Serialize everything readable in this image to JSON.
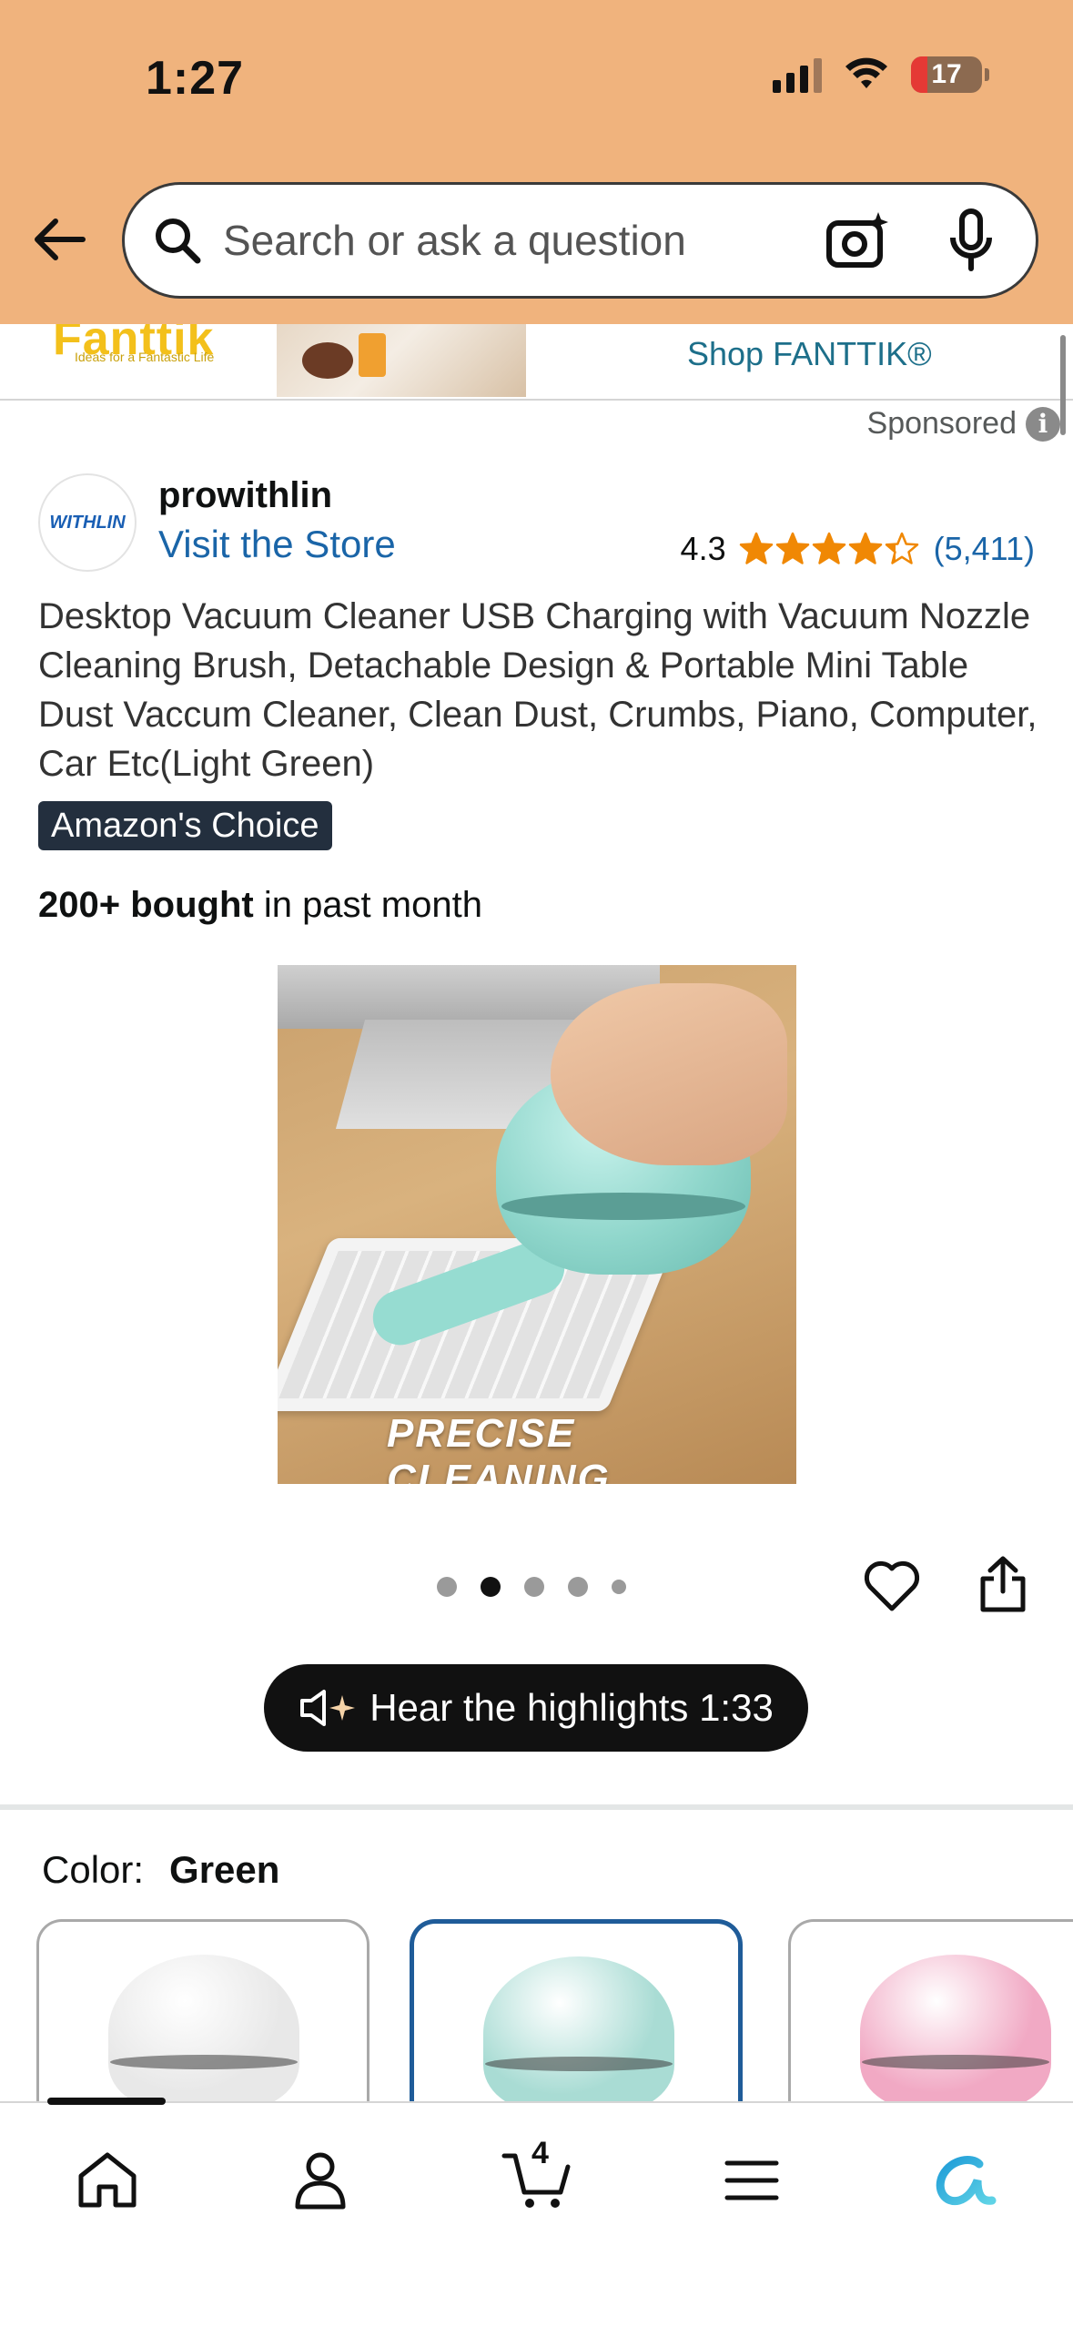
{
  "status_bar": {
    "time": "1:27",
    "battery": "17"
  },
  "search": {
    "placeholder": "Search or ask a question"
  },
  "ad_banner": {
    "logo": "Fanttik",
    "logo_tagline": "Ideas for a Fantastic Life",
    "shop_link": "Shop FANTTIK®"
  },
  "sponsored_label": "Sponsored",
  "product": {
    "brand": "prowithlin",
    "brand_logo_text": "WITHLIN",
    "visit_store": "Visit the Store",
    "rating": "4.3",
    "rating_stars": 4.3,
    "rating_count": "(5,411)",
    "title": "Desktop Vacuum Cleaner USB Charging with Vacuum Nozzle Cleaning Brush, Detachable Design & Portable Mini Table Dust Vaccum Cleaner, Clean Dust, Crumbs, Piano, Computer, Car Etc(Light Green)",
    "badge": "Amazon's Choice",
    "bought_bold": "200+ bought",
    "bought_rest": " in past month",
    "image_caption": "PRECISE CLEANING",
    "carousel_total": 5,
    "carousel_active": 2,
    "highlights_label": "Hear the highlights 1:33",
    "color_label": "Color:",
    "color_value": "Green",
    "swatch_colors": [
      "#e8e8e8",
      "#a9dcd4",
      "#f1a9c4"
    ]
  },
  "nav": {
    "cart_count": "4",
    "items": [
      "home-icon",
      "account-icon",
      "cart-icon",
      "menu-icon",
      "rufus-icon"
    ]
  },
  "colors": {
    "header": "#f0b37d",
    "link": "#1a65a8",
    "star": "#f08804",
    "badge_bg": "#232f3e",
    "selected_border": "#1f5c99"
  }
}
